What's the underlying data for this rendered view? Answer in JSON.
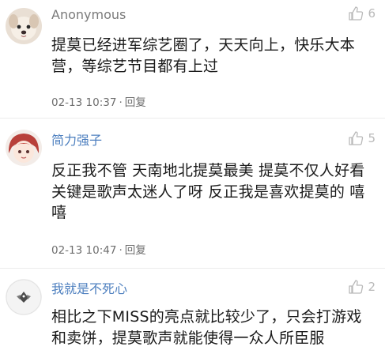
{
  "comments": [
    {
      "username": "Anonymous",
      "likes": "6",
      "text": "提莫已经进军综艺圈了，天天向上，快乐大本营，等综艺节目都有上过",
      "time": "02-13 10:37",
      "reply_label": "回复",
      "avatar_icon": "dog-avatar-icon"
    },
    {
      "username": "简力强子",
      "likes": "5",
      "text": "反正我不管 天南地北提莫最美 提莫不仅人好看 关键是歌声太迷人了呀 反正我是喜欢提莫的 嘻嘻",
      "time": "02-13 10:47",
      "reply_label": "回复",
      "avatar_icon": "anime-girl-avatar-icon"
    },
    {
      "username": "我就是不死心",
      "likes": "2",
      "text": "相比之下MISS的亮点就比较少了，只会打游戏和卖饼，提莫歌声就能使得一众人所臣服",
      "avatar_icon": "bird-avatar-icon"
    }
  ],
  "colors": {
    "username_blue": "#4d7fbf",
    "anon_gray": "#7a7a7a",
    "meta_gray": "#6e6e6e",
    "like_gray": "#b9b9b9"
  }
}
